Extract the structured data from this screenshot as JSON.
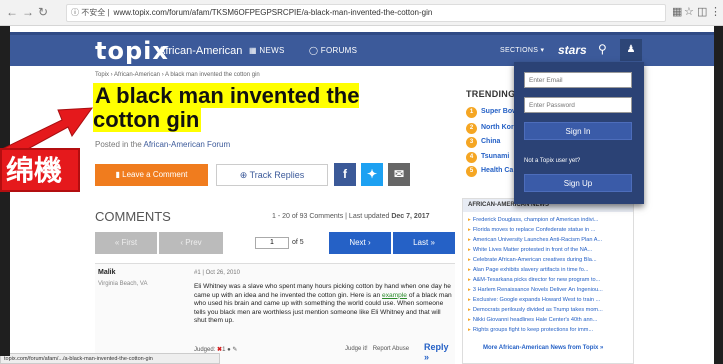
{
  "browser": {
    "security_label": "不安全",
    "url": "www.topix.com/forum/afam/TKSM6OFPEGPSRCPIE/a-black-man-invented-the-cotton-gin",
    "status_url": "topix.com/forum/afam/.../a-black-man-invented-the-cotton-gin"
  },
  "header": {
    "logo": "topix",
    "forum_name": "African-American",
    "news_label": "NEWS",
    "forums_label": "FORUMS",
    "sections_label": "SECTIONS",
    "stars_label": "stars"
  },
  "breadcrumb": "Topix › African-American › A black man invented the cotton gin",
  "article": {
    "title": "A black man invented the cotton gin",
    "posted_prefix": "Posted in the",
    "posted_forum": "African-American Forum"
  },
  "actions": {
    "leave_comment": "Leave a Comment",
    "track_replies": "Track Replies"
  },
  "comments": {
    "heading": "COMMENTS",
    "range": "1 - 20 of 93 Comments",
    "updated_label": "Last updated",
    "updated_date": "Dec 7, 2017"
  },
  "pager": {
    "first": "First",
    "prev": "Prev",
    "current_page": "1",
    "of_label": "of 5",
    "next": "Next",
    "last": "Last"
  },
  "comment": {
    "author": "Malik",
    "location": "Virginia Beach, VA",
    "number": "#1",
    "date": "Oct 26, 2010",
    "body_1": "Eli Whitney was a slave who spent many hours picking cotton by hand when one day he came up with an idea and he invented the cotton gin. Here is an ",
    "body_link": "example",
    "body_2": " of a black man who used his brain and came up with something the world could use. When someone tells you black men are worthless just mention someone like Eli Whitney and that will shut them up.",
    "judged_label": "Judged:",
    "judge_it": "Judge it!",
    "report_abuse": "Report Abuse",
    "reply": "Reply »"
  },
  "trending": {
    "heading": "TRENDING",
    "items": [
      {
        "num": "1",
        "label": "Super Bow"
      },
      {
        "num": "2",
        "label": "North Kor"
      },
      {
        "num": "3",
        "label": "China"
      },
      {
        "num": "4",
        "label": "Tsunami"
      },
      {
        "num": "5",
        "label": "Health Ca"
      }
    ]
  },
  "aa_news": {
    "heading": "AFRICAN-AMERICAN NEWS",
    "items": [
      "Frederick Douglass, champion of American indivi...",
      "Florida moves to replace Confederate statue in ...",
      "American University Launches Anti-Racism Plan A...",
      "White Lives Matter protested in front of the NA...",
      "Celebrate African-American creatives during Bla...",
      "Alan Page exhibits slavery artifacts in time fo...",
      "A&M-Texarkana picks director for new program to...",
      "3 Harlem Renaissance Novels Deliver An Ingeniou...",
      "Exclusive: Google expands Howard West to train ...",
      "Democrats perilously divided as Trump takes mom...",
      "Nikki Giovanni headlines Hale Center's 40th ann...",
      "Rights groups fight to keep protections for imm..."
    ],
    "more": "More African-American News from Topix »"
  },
  "login": {
    "email_placeholder": "Enter Email",
    "password_placeholder": "Enter Password",
    "sign_in": "Sign In",
    "not_user": "Not a Topix user yet?",
    "sign_up": "Sign Up"
  },
  "overlay": {
    "text": "绵機"
  },
  "colors": {
    "header_blue": "#3c5a9a",
    "accent_orange": "#f07c1e",
    "link_blue": "#2561c6",
    "highlight_yellow": "#ffff00",
    "overlay_red": "#e5191c"
  }
}
